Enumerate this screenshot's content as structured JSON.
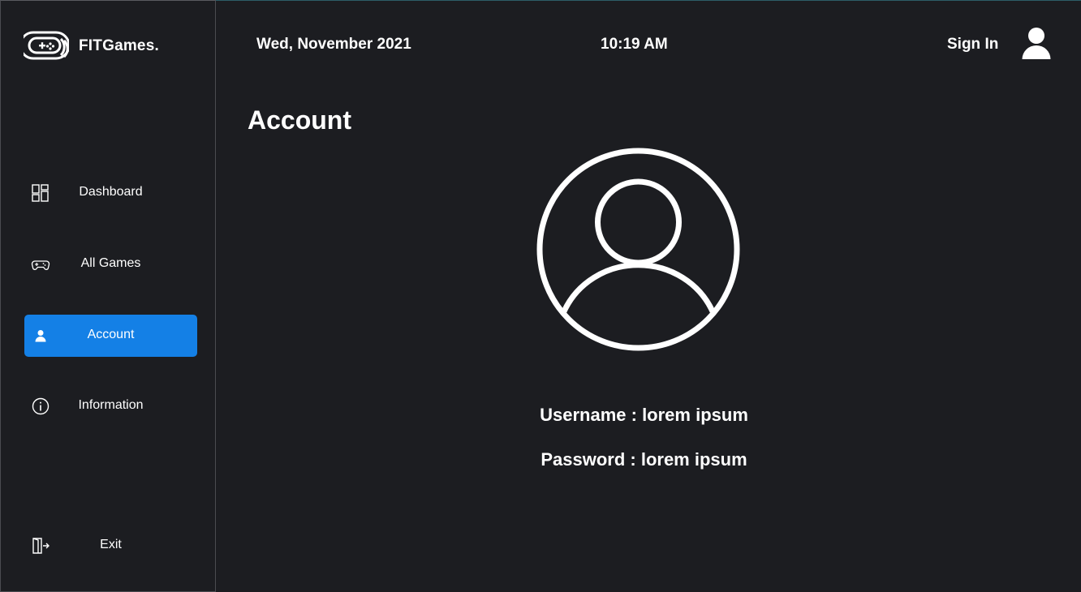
{
  "brand": {
    "name": "FITGames.",
    "logo_icon": "gamepad-logo-icon"
  },
  "header": {
    "date": "Wed, November 2021",
    "time": "10:19 AM",
    "sign_in_label": "Sign In",
    "avatar_icon": "user-icon"
  },
  "sidebar": {
    "items": [
      {
        "label": "Dashboard",
        "icon": "dashboard-icon",
        "active": false
      },
      {
        "label": "All Games",
        "icon": "gamepad-icon",
        "active": false
      },
      {
        "label": "Account",
        "icon": "user-icon",
        "active": true
      },
      {
        "label": "Information",
        "icon": "info-icon",
        "active": false
      }
    ],
    "exit": {
      "label": "Exit",
      "icon": "exit-icon"
    }
  },
  "main": {
    "title": "Account",
    "profile_icon": "user-circle-icon",
    "username_line": "Username : lorem ipsum",
    "password_line": "Password : lorem ipsum"
  },
  "colors": {
    "background": "#1c1d21",
    "accent": "#1480e6",
    "text": "#ffffff",
    "border": "#4a4b50"
  }
}
